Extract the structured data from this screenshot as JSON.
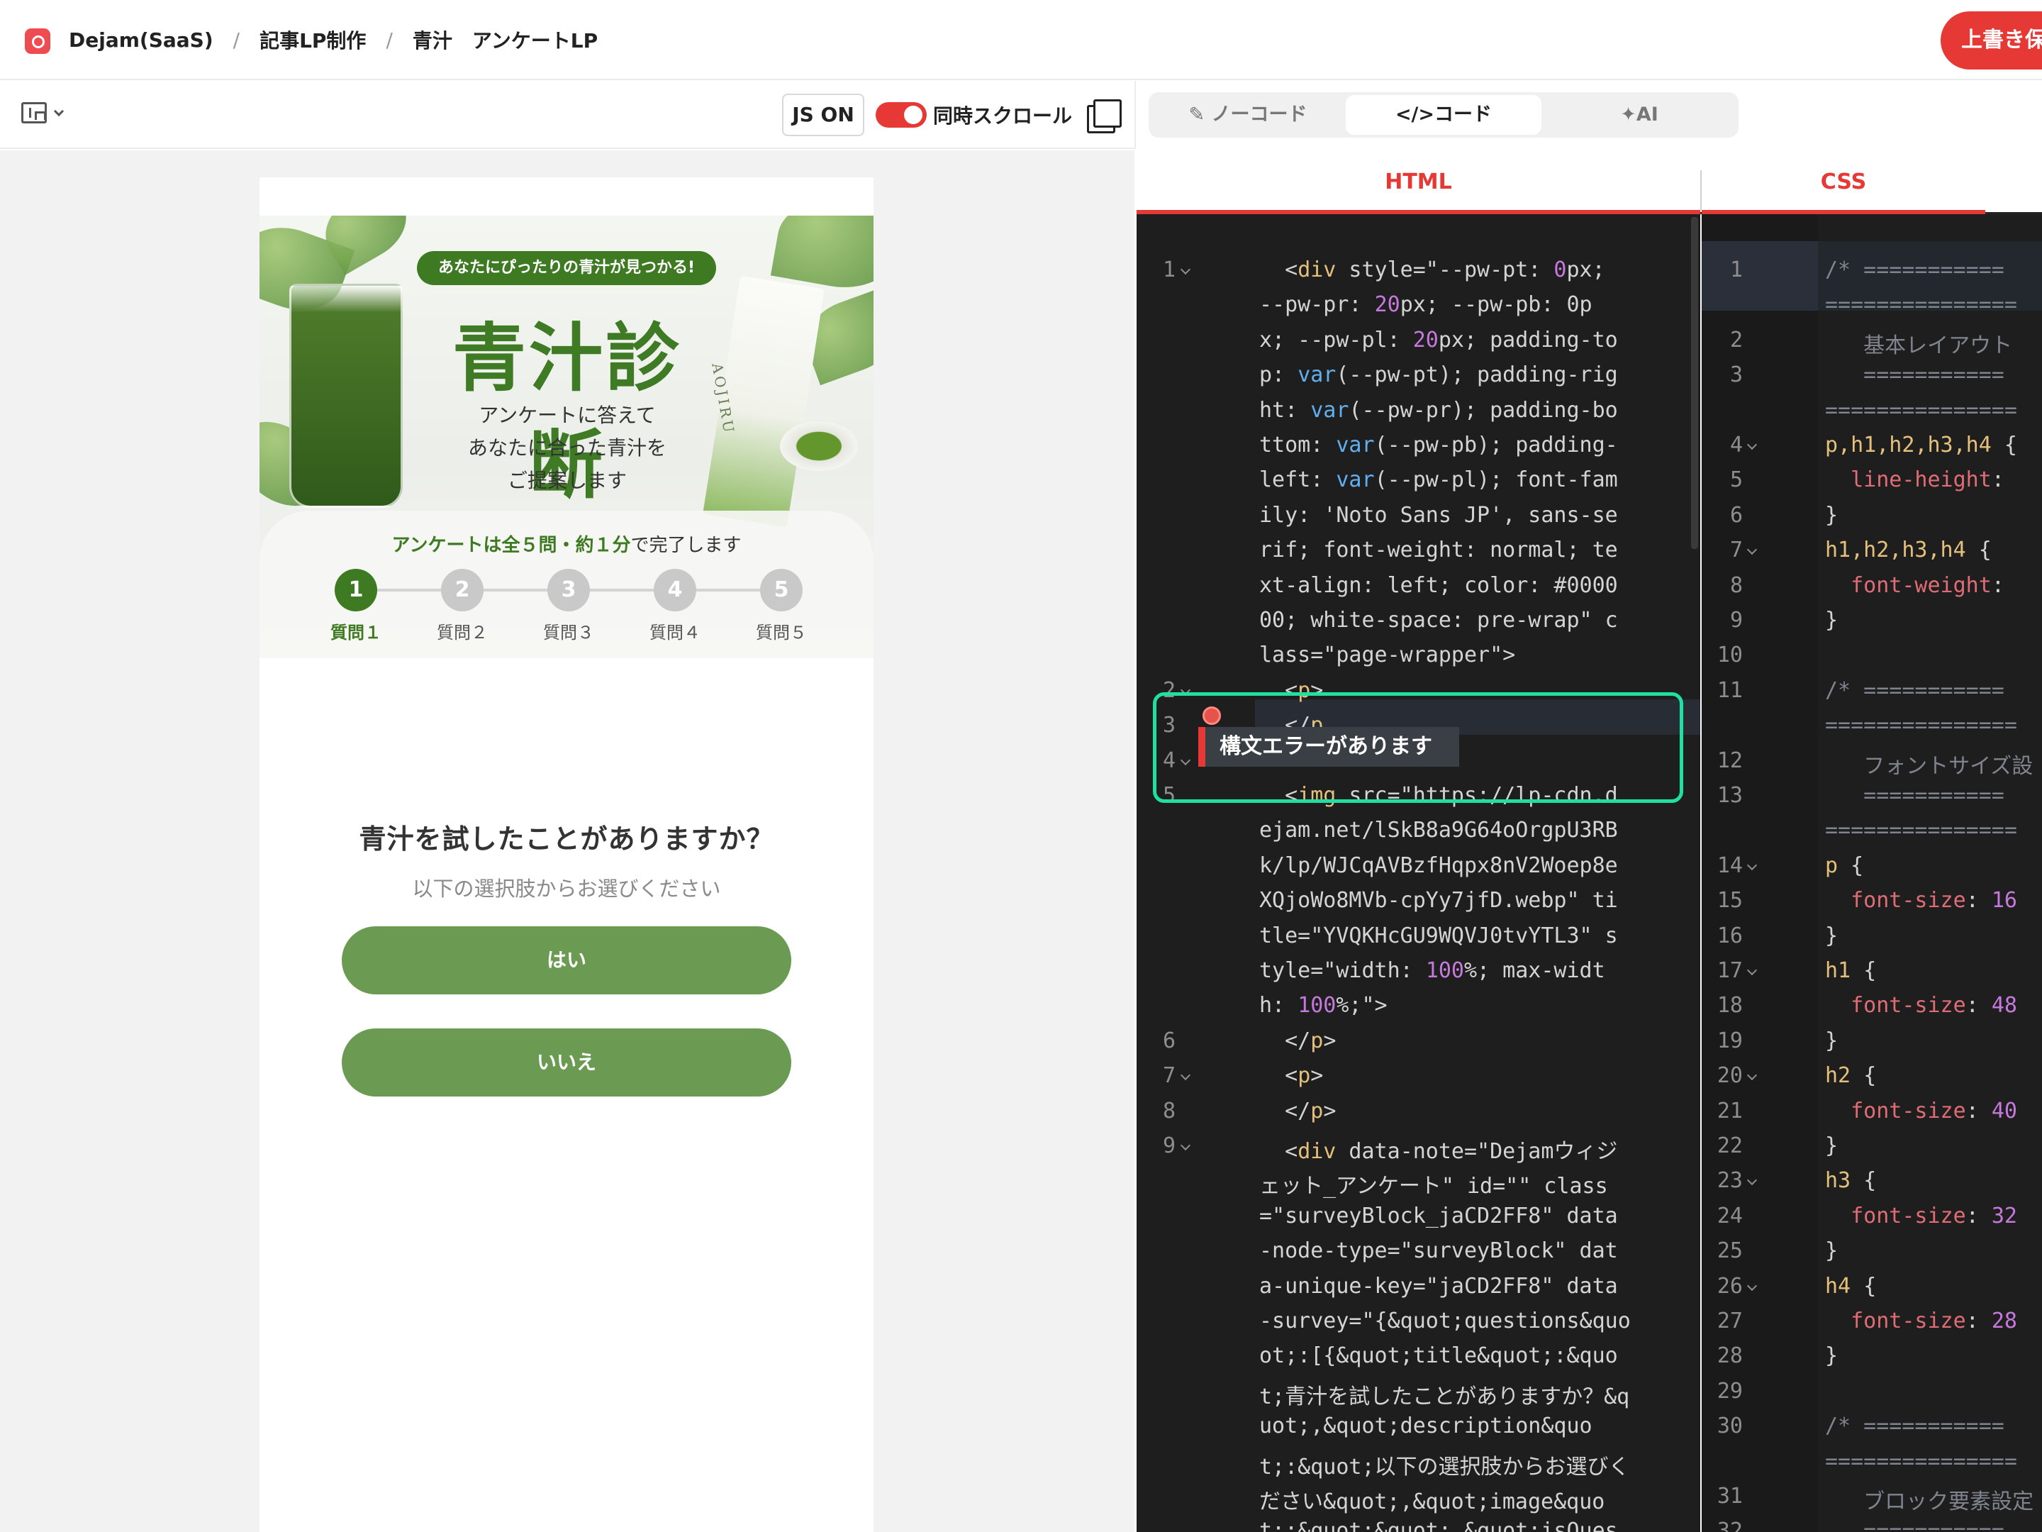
{
  "header": {
    "breadcrumbs": [
      "Dejam(SaaS)",
      "記事LP制作",
      "青汁　アンケートLP"
    ],
    "separator": "/",
    "save_label": "上書き保"
  },
  "left_toolbar": {
    "js_label": "JS ON",
    "sync_scroll_label": "同時スクロール"
  },
  "preview": {
    "hero": {
      "badge": "あなたにぴったりの青汁が見つかる!",
      "title": "青汁診断",
      "subtitle_lines": [
        "アンケートに答えて",
        "あなたに合った青汁を",
        "ご提案します"
      ],
      "product_text": "AOJIRU"
    },
    "steps_caption_em": "アンケートは全５問・約１分",
    "steps_caption_rest": "で完了します",
    "steps": [
      {
        "number": "1",
        "label": "質問１",
        "active": true
      },
      {
        "number": "2",
        "label": "質問２",
        "active": false
      },
      {
        "number": "3",
        "label": "質問３",
        "active": false
      },
      {
        "number": "4",
        "label": "質問４",
        "active": false
      },
      {
        "number": "5",
        "label": "質問５",
        "active": false
      }
    ],
    "question": "青汁を試したことがありますか？",
    "description": "以下の選択肢からお選びください",
    "answers": [
      "はい",
      "いいえ"
    ]
  },
  "editor_mode_tabs": [
    {
      "label": "ノーコード",
      "active": false
    },
    {
      "label": "コード",
      "active": true
    },
    {
      "label": "AI",
      "active": false
    }
  ],
  "code_tabs": [
    "HTML",
    "CSS"
  ],
  "error_tooltip": "構文エラーがあります",
  "html_line_numbers": [
    "1",
    "2",
    "3",
    "4",
    "5",
    "6",
    "7",
    "8",
    "9"
  ],
  "css_line_numbers": [
    "1",
    "2",
    "3",
    "4",
    "5",
    "6",
    "7",
    "8",
    "9",
    "10",
    "11",
    "12",
    "13",
    "14",
    "15",
    "16",
    "17",
    "18",
    "19",
    "20",
    "21",
    "22",
    "23",
    "24",
    "25",
    "26",
    "27",
    "28",
    "29",
    "30",
    "31",
    "32"
  ],
  "html_code_lines": [
    "  <div style=\"--pw-pt: 0px;",
    "--pw-pr: 20px; --pw-pb: 0p",
    "x; --pw-pl: 20px; padding-to",
    "p: var(--pw-pt); padding-rig",
    "ht: var(--pw-pr); padding-bo",
    "ttom: var(--pw-pb); padding-",
    "left: var(--pw-pl); font-fam",
    "ily: 'Noto Sans JP', sans-se",
    "rif; font-weight: normal; te",
    "xt-align: left; color: #0000",
    "00; white-space: pre-wrap\" c",
    "lass=\"page-wrapper\">",
    "  <p>",
    "  </p",
    "",
    "  <img src=\"https://lp-cdn.d",
    "ejam.net/lSkB8a9G64oOrgpU3RB",
    "k/lp/WJCqAVBzfHqpx8nV2Woep8e",
    "XQjoWo8MVb-cpYy7jfD.webp\" ti",
    "tle=\"YVQKHcGU9WQVJ0tvYTL3\" s",
    "tyle=\"width: 100%; max-widt",
    "h: 100%;\">",
    "  </p>",
    "  <p>",
    "  </p>",
    "  <div data-note=\"Dejamウィジ",
    "ェット_アンケート\" id=\"\" class",
    "=\"surveyBlock_jaCD2FF8\" data",
    "-node-type=\"surveyBlock\" dat",
    "a-unique-key=\"jaCD2FF8\" data",
    "-survey=\"{&quot;questions&quo",
    "ot;:[{&quot;title&quot;:&quo",
    "t;青汁を試したことがありますか？&q",
    "uot;,&quot;description&quo",
    "t;:&quot;以下の選択肢からお選びく",
    "ださい&quot;,&quot;image&quo",
    "t;:&quot;&quot;,&quot;isQues"
  ],
  "css_code_lines": [
    "/* ===========",
    "===============",
    "   基本レイアウト",
    "   ===========",
    "===============",
    "p,h1,h2,h3,h4 {",
    "  line-height:",
    "}",
    "h1,h2,h3,h4 {",
    "  font-weight:",
    "}",
    "",
    "/* ===========",
    "===============",
    "   フォントサイズ設",
    "   ===========",
    "===============",
    "p {",
    "  font-size: 16",
    "}",
    "h1 {",
    "  font-size: 48",
    "}",
    "h2 {",
    "  font-size: 40",
    "}",
    "h3 {",
    "  font-size: 32",
    "}",
    "h4 {",
    "  font-size: 28",
    "}",
    "",
    "/* ===========",
    "===============",
    "   ブロック要素設定",
    "   ==========="
  ],
  "colors": {
    "accent_red": "#e63834",
    "brand_green": "#3e7a22",
    "answer_green": "#6b9a53",
    "editor_bg": "#1e1e1e",
    "highlight": "#1fe0a0"
  },
  "icons": [
    "app-logo-icon",
    "layout-icon",
    "chevron-down-icon",
    "toggle-switch",
    "window-icon",
    "pencil-icon",
    "code-icon",
    "sparkle-icon",
    "error-dot-icon"
  ]
}
